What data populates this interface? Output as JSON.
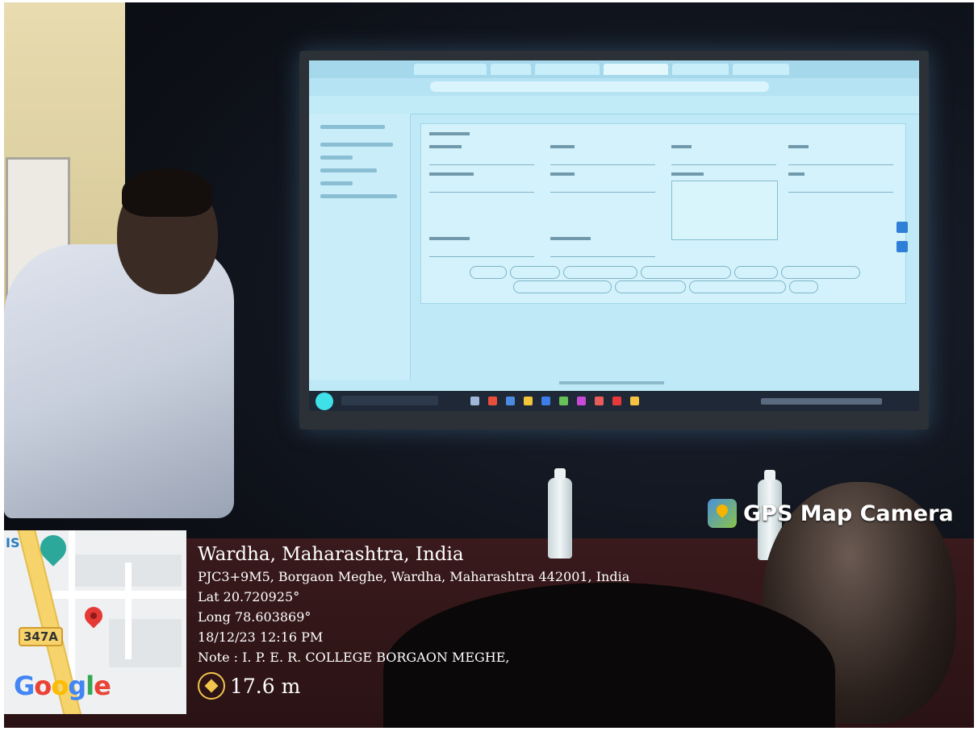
{
  "overlay": {
    "app_title": "GPS Map Camera",
    "location_title": "Wardha, Maharashtra, India",
    "address": "PJC3+9M5, Borgaon Meghe, Wardha, Maharashtra 442001, India",
    "lat": "Lat 20.720925°",
    "long": "Long 78.603869°",
    "datetime": "18/12/23 12:16 PM",
    "note": "Note : I. P. E. R. COLLEGE BORGAON MEGHE,",
    "accuracy": "17.6 m"
  },
  "map": {
    "route_label": "347A",
    "poi_label": "IS",
    "logo_text": "Google",
    "logo_colors": [
      "#4285F4",
      "#EA4335",
      "#FBBC05",
      "#4285F4",
      "#34A853",
      "#EA4335"
    ]
  },
  "colors": {
    "screen": "#bfe9f7",
    "pin": "#e53935",
    "accent": "#f1c54d"
  }
}
